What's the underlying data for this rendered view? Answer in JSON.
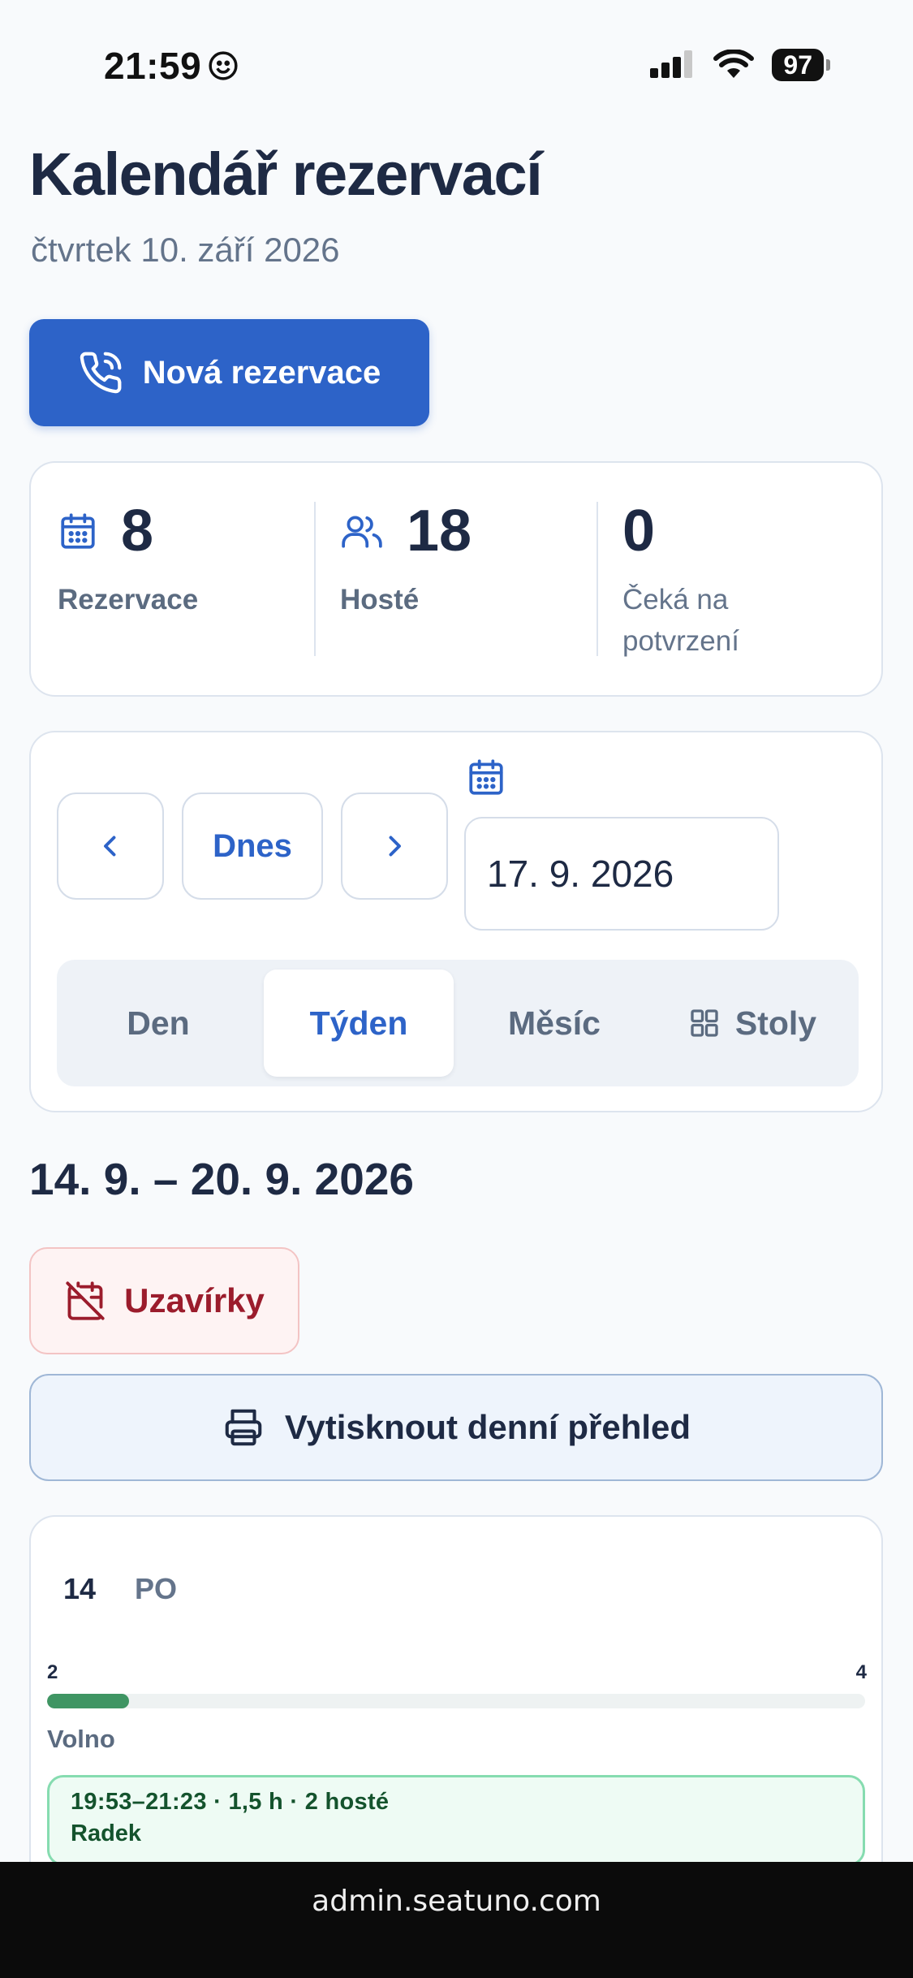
{
  "status_bar": {
    "time": "21:59",
    "battery": "97"
  },
  "header": {
    "title": "Kalendář rezervací",
    "subtitle": "čtvrtek 10. září 2026"
  },
  "new_reservation": {
    "label": "Nová rezervace"
  },
  "stats": [
    {
      "value": "8",
      "label": "Rezervace",
      "icon": "calendar-icon"
    },
    {
      "value": "18",
      "label": "Hosté",
      "icon": "users-icon"
    },
    {
      "value": "0",
      "label": "Čeká na potvrzení"
    }
  ],
  "nav": {
    "today_label": "Dnes",
    "date_value": "17. 9. 2026"
  },
  "view_tabs": [
    "Den",
    "Týden",
    "Měsíc",
    "Stoly"
  ],
  "active_tab": "Týden",
  "range_title": "14. 9. – 20. 9. 2026",
  "closures_label": "Uzavírky",
  "print_label": "Vytisknout denní přehled",
  "day": {
    "number": "14",
    "name": "PO",
    "capacity_min": "2",
    "capacity_max": "4",
    "capacity_fill": 0.1,
    "status": "Volno",
    "reservation": {
      "time": "19:53–21:23 · 1,5 h · 2 hosté",
      "name": "Radek"
    }
  },
  "browser": {
    "url": "admin.seatuno.com"
  },
  "colors": {
    "accent": "#2d63c8",
    "closure": "#9b1c2c",
    "success": "#3f9563"
  }
}
